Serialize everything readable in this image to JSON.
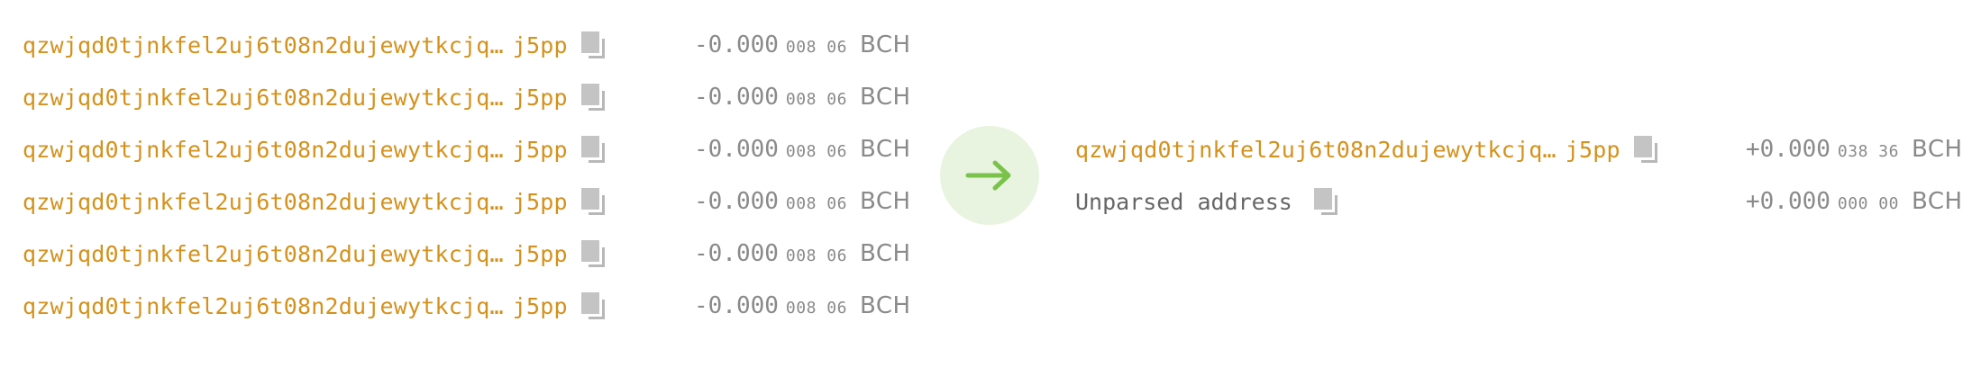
{
  "colors": {
    "address": "#d4911c",
    "amount": "#8a8a8a",
    "arrow": "#7bc24a",
    "arrow_bg": "#e8f4df",
    "copy_icon": "#c4c4c4"
  },
  "inputs": [
    {
      "address_head": "qzwjqd0tjnkfel2uj6t08n2dujewytkcjq…",
      "address_tail": "j5pp",
      "amount_main": "-0.000",
      "amount_small": "008 06",
      "unit": "BCH"
    },
    {
      "address_head": "qzwjqd0tjnkfel2uj6t08n2dujewytkcjq…",
      "address_tail": "j5pp",
      "amount_main": "-0.000",
      "amount_small": "008 06",
      "unit": "BCH"
    },
    {
      "address_head": "qzwjqd0tjnkfel2uj6t08n2dujewytkcjq…",
      "address_tail": "j5pp",
      "amount_main": "-0.000",
      "amount_small": "008 06",
      "unit": "BCH"
    },
    {
      "address_head": "qzwjqd0tjnkfel2uj6t08n2dujewytkcjq…",
      "address_tail": "j5pp",
      "amount_main": "-0.000",
      "amount_small": "008 06",
      "unit": "BCH"
    },
    {
      "address_head": "qzwjqd0tjnkfel2uj6t08n2dujewytkcjq…",
      "address_tail": "j5pp",
      "amount_main": "-0.000",
      "amount_small": "008 06",
      "unit": "BCH"
    },
    {
      "address_head": "qzwjqd0tjnkfel2uj6t08n2dujewytkcjq…",
      "address_tail": "j5pp",
      "amount_main": "-0.000",
      "amount_small": "008 06",
      "unit": "BCH"
    }
  ],
  "direction_icon": "arrow-right-icon",
  "outputs": [
    {
      "address_head": "qzwjqd0tjnkfel2uj6t08n2dujewytkcjq…",
      "address_tail": "j5pp",
      "amount_main": "+0.000",
      "amount_small": "038 36",
      "unit": "BCH"
    },
    {
      "label": "Unparsed address",
      "amount_main": "+0.000",
      "amount_small": "000 00",
      "unit": "BCH"
    }
  ]
}
